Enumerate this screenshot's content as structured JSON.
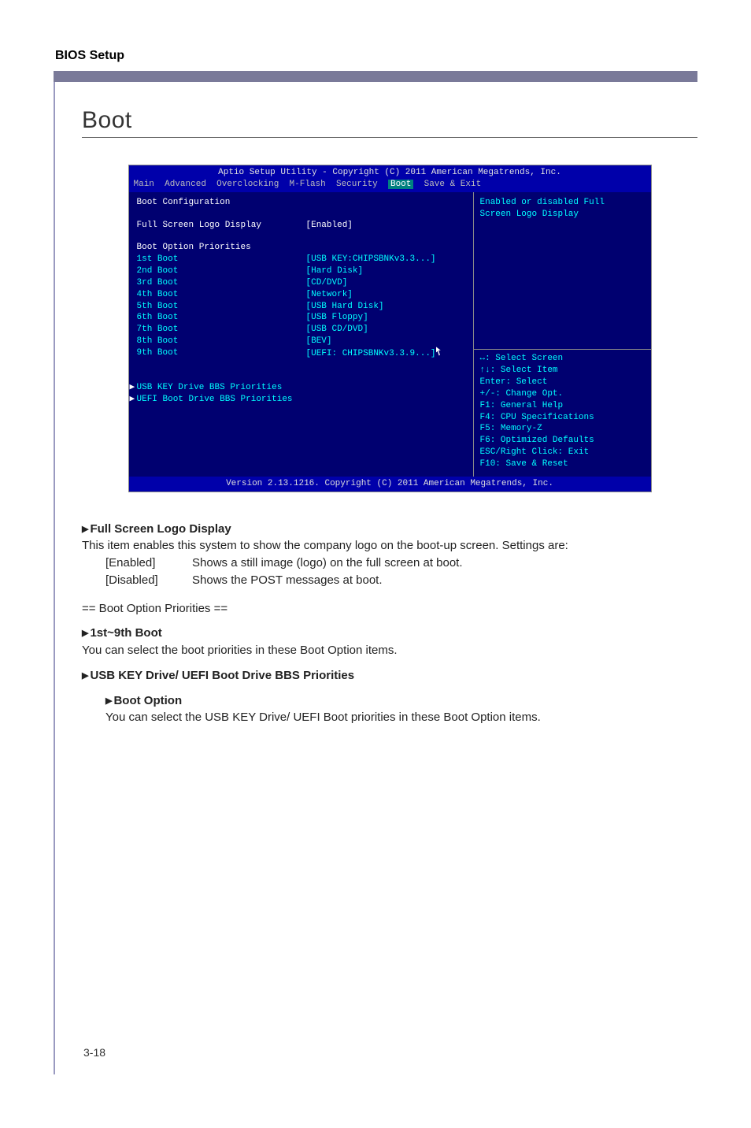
{
  "header": {
    "title": "BIOS Setup"
  },
  "heading": "Boot",
  "bios": {
    "title": "Aptio Setup Utility - Copyright (C) 2011 American Megatrends, Inc.",
    "menu": {
      "items": [
        "Main",
        "Advanced",
        "Overclocking",
        "M-Flash",
        "Security",
        "Boot",
        "Save & Exit"
      ],
      "selected_index": 5
    },
    "left": {
      "group1_title": "Boot Configuration",
      "logo_label": "Full Screen Logo Display",
      "logo_value": "[Enabled]",
      "group2_title": "Boot Option Priorities",
      "boots": [
        {
          "label": "1st Boot",
          "value": "[USB KEY:CHIPSBNKv3.3...]"
        },
        {
          "label": "2nd Boot",
          "value": "[Hard Disk]"
        },
        {
          "label": "3rd Boot",
          "value": "[CD/DVD]"
        },
        {
          "label": "4th Boot",
          "value": "[Network]"
        },
        {
          "label": "5th Boot",
          "value": "[USB Hard Disk]"
        },
        {
          "label": "6th Boot",
          "value": "[USB Floppy]"
        },
        {
          "label": "7th Boot",
          "value": "[USB CD/DVD]"
        },
        {
          "label": "8th Boot",
          "value": "[BEV]"
        },
        {
          "label": "9th Boot",
          "value": "[UEFI: CHIPSBNKv3.3.9...]"
        }
      ],
      "submenu1": "USB KEY Drive BBS Priorities",
      "submenu2": "UEFI Boot Drive BBS Priorities"
    },
    "right": {
      "help_line1": "Enabled or disabled Full",
      "help_line2": "Screen Logo Display",
      "hints": [
        "↔: Select Screen",
        "↑↓: Select Item",
        "Enter: Select",
        "+/-: Change Opt.",
        "F1: General Help",
        "F4: CPU Specifications",
        "F5: Memory-Z",
        "F6: Optimized Defaults",
        "ESC/Right Click: Exit",
        "F10: Save & Reset"
      ]
    },
    "footer": "Version 2.13.1216. Copyright (C) 2011 American Megatrends, Inc."
  },
  "doc": {
    "item1_title": "Full Screen Logo Display",
    "item1_desc": "This item enables this system to show the company logo on the boot-up screen. Settings are:",
    "item1_opt1_k": "[Enabled]",
    "item1_opt1_v": "Shows a still image (logo) on the full screen at boot.",
    "item1_opt2_k": "[Disabled]",
    "item1_opt2_v": "Shows the POST messages at boot.",
    "divider": "== Boot Option Priorities ==",
    "item2_title": "1st~9th Boot",
    "item2_desc": "You can select the boot priorities in these Boot Option items.",
    "item3_title": "USB KEY Drive/ UEFI Boot Drive BBS Priorities",
    "item4_title": "Boot Option",
    "item4_desc": "You can select the USB KEY Drive/ UEFI Boot priorities in these Boot Option items."
  },
  "page_number": "3-18"
}
